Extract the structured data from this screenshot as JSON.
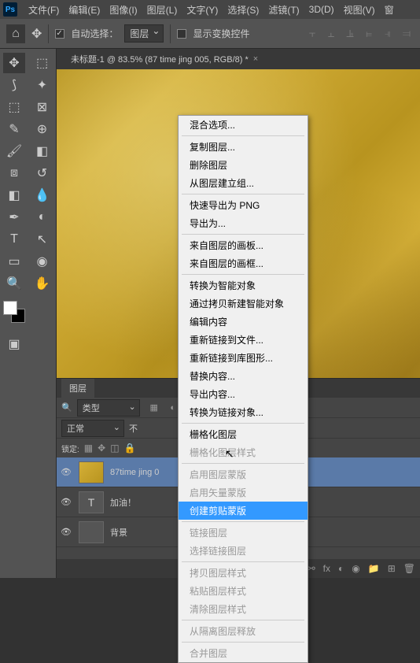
{
  "menubar": [
    "文件(F)",
    "编辑(E)",
    "图像(I)",
    "图层(L)",
    "文字(Y)",
    "选择(S)",
    "滤镜(T)",
    "3D(D)",
    "视图(V)",
    "窗"
  ],
  "options": {
    "auto_select": "自动选择：",
    "target": "图层",
    "show_transform": "显示变换控件"
  },
  "doc_tab": "未标题-1 @ 83.5% (87 time jing 005, RGB/8) *",
  "layers": {
    "tab": "图层",
    "kind": "类型",
    "blend": "正常",
    "opacity_lbl": "不",
    "lock_lbl": "锁定:",
    "items": [
      {
        "name": "87time jing 0",
        "type": "gold",
        "selected": true
      },
      {
        "name": "加油！",
        "type": "T",
        "selected": false
      },
      {
        "name": "背景",
        "type": "bg",
        "selected": false
      }
    ]
  },
  "ctx": [
    {
      "t": "混合选项...",
      "d": false
    },
    {
      "sep": true
    },
    {
      "t": "复制图层...",
      "d": false
    },
    {
      "t": "删除图层",
      "d": false
    },
    {
      "t": "从图层建立组...",
      "d": false
    },
    {
      "sep": true
    },
    {
      "t": "快速导出为 PNG",
      "d": false
    },
    {
      "t": "导出为...",
      "d": false
    },
    {
      "sep": true
    },
    {
      "t": "来自图层的画板...",
      "d": false
    },
    {
      "t": "来自图层的画框...",
      "d": false
    },
    {
      "sep": true
    },
    {
      "t": "转换为智能对象",
      "d": false
    },
    {
      "t": "通过拷贝新建智能对象",
      "d": false
    },
    {
      "t": "编辑内容",
      "d": false
    },
    {
      "t": "重新链接到文件...",
      "d": false
    },
    {
      "t": "重新链接到库图形...",
      "d": false
    },
    {
      "t": "替换内容...",
      "d": false
    },
    {
      "t": "导出内容...",
      "d": false
    },
    {
      "t": "转换为链接对象...",
      "d": false
    },
    {
      "sep": true
    },
    {
      "t": "栅格化图层",
      "d": false
    },
    {
      "t": "栅格化图层样式",
      "d": true
    },
    {
      "sep": true
    },
    {
      "t": "启用图层蒙版",
      "d": true
    },
    {
      "t": "启用矢量蒙版",
      "d": true
    },
    {
      "t": "创建剪贴蒙版",
      "d": false,
      "hover": true
    },
    {
      "sep": true
    },
    {
      "t": "链接图层",
      "d": true
    },
    {
      "t": "选择链接图层",
      "d": true
    },
    {
      "sep": true
    },
    {
      "t": "拷贝图层样式",
      "d": true
    },
    {
      "t": "粘贴图层样式",
      "d": true
    },
    {
      "t": "清除图层样式",
      "d": true
    },
    {
      "sep": true
    },
    {
      "t": "从隔离图层释放",
      "d": true
    },
    {
      "sep": true
    },
    {
      "t": "合并图层",
      "d": true
    }
  ]
}
